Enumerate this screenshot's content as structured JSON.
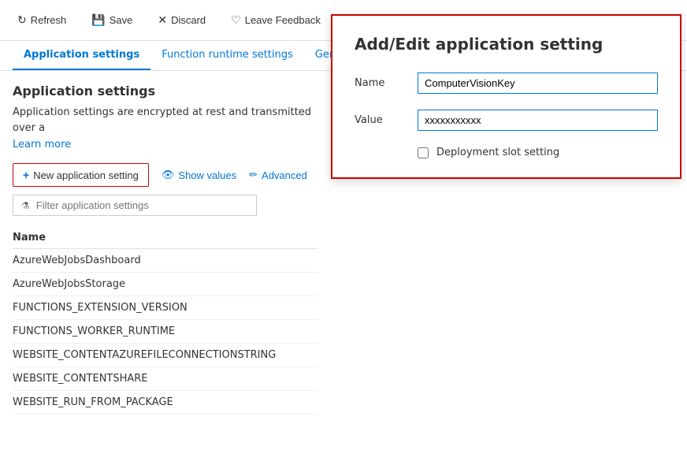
{
  "toolbar": {
    "refresh_label": "Refresh",
    "save_label": "Save",
    "discard_label": "Discard",
    "feedback_label": "Leave Feedback"
  },
  "tabs": {
    "tab1": "Application settings",
    "tab2": "Function runtime settings",
    "tab3": "General"
  },
  "main": {
    "section_title": "Application settings",
    "description": "Application settings are encrypted at rest and transmitted over a",
    "learn_more": "Learn more",
    "new_setting_btn": "New application setting",
    "show_values_btn": "Show values",
    "advanced_btn": "Advanced",
    "filter_placeholder": "Filter application settings",
    "table": {
      "column_name": "Name",
      "rows": [
        "AzureWebJobsDashboard",
        "AzureWebJobsStorage",
        "FUNCTIONS_EXTENSION_VERSION",
        "FUNCTIONS_WORKER_RUNTIME",
        "WEBSITE_CONTENTAZUREFILECONNECTIONSTRING",
        "WEBSITE_CONTENTSHARE",
        "WEBSITE_RUN_FROM_PACKAGE"
      ]
    }
  },
  "panel": {
    "title": "Add/Edit application setting",
    "name_label": "Name",
    "name_value": "ComputerVisionKey",
    "value_label": "Value",
    "value_value": "xxxxxxxxxxx",
    "deployment_slot_label": "Deployment slot setting",
    "deployment_slot_checked": false
  }
}
